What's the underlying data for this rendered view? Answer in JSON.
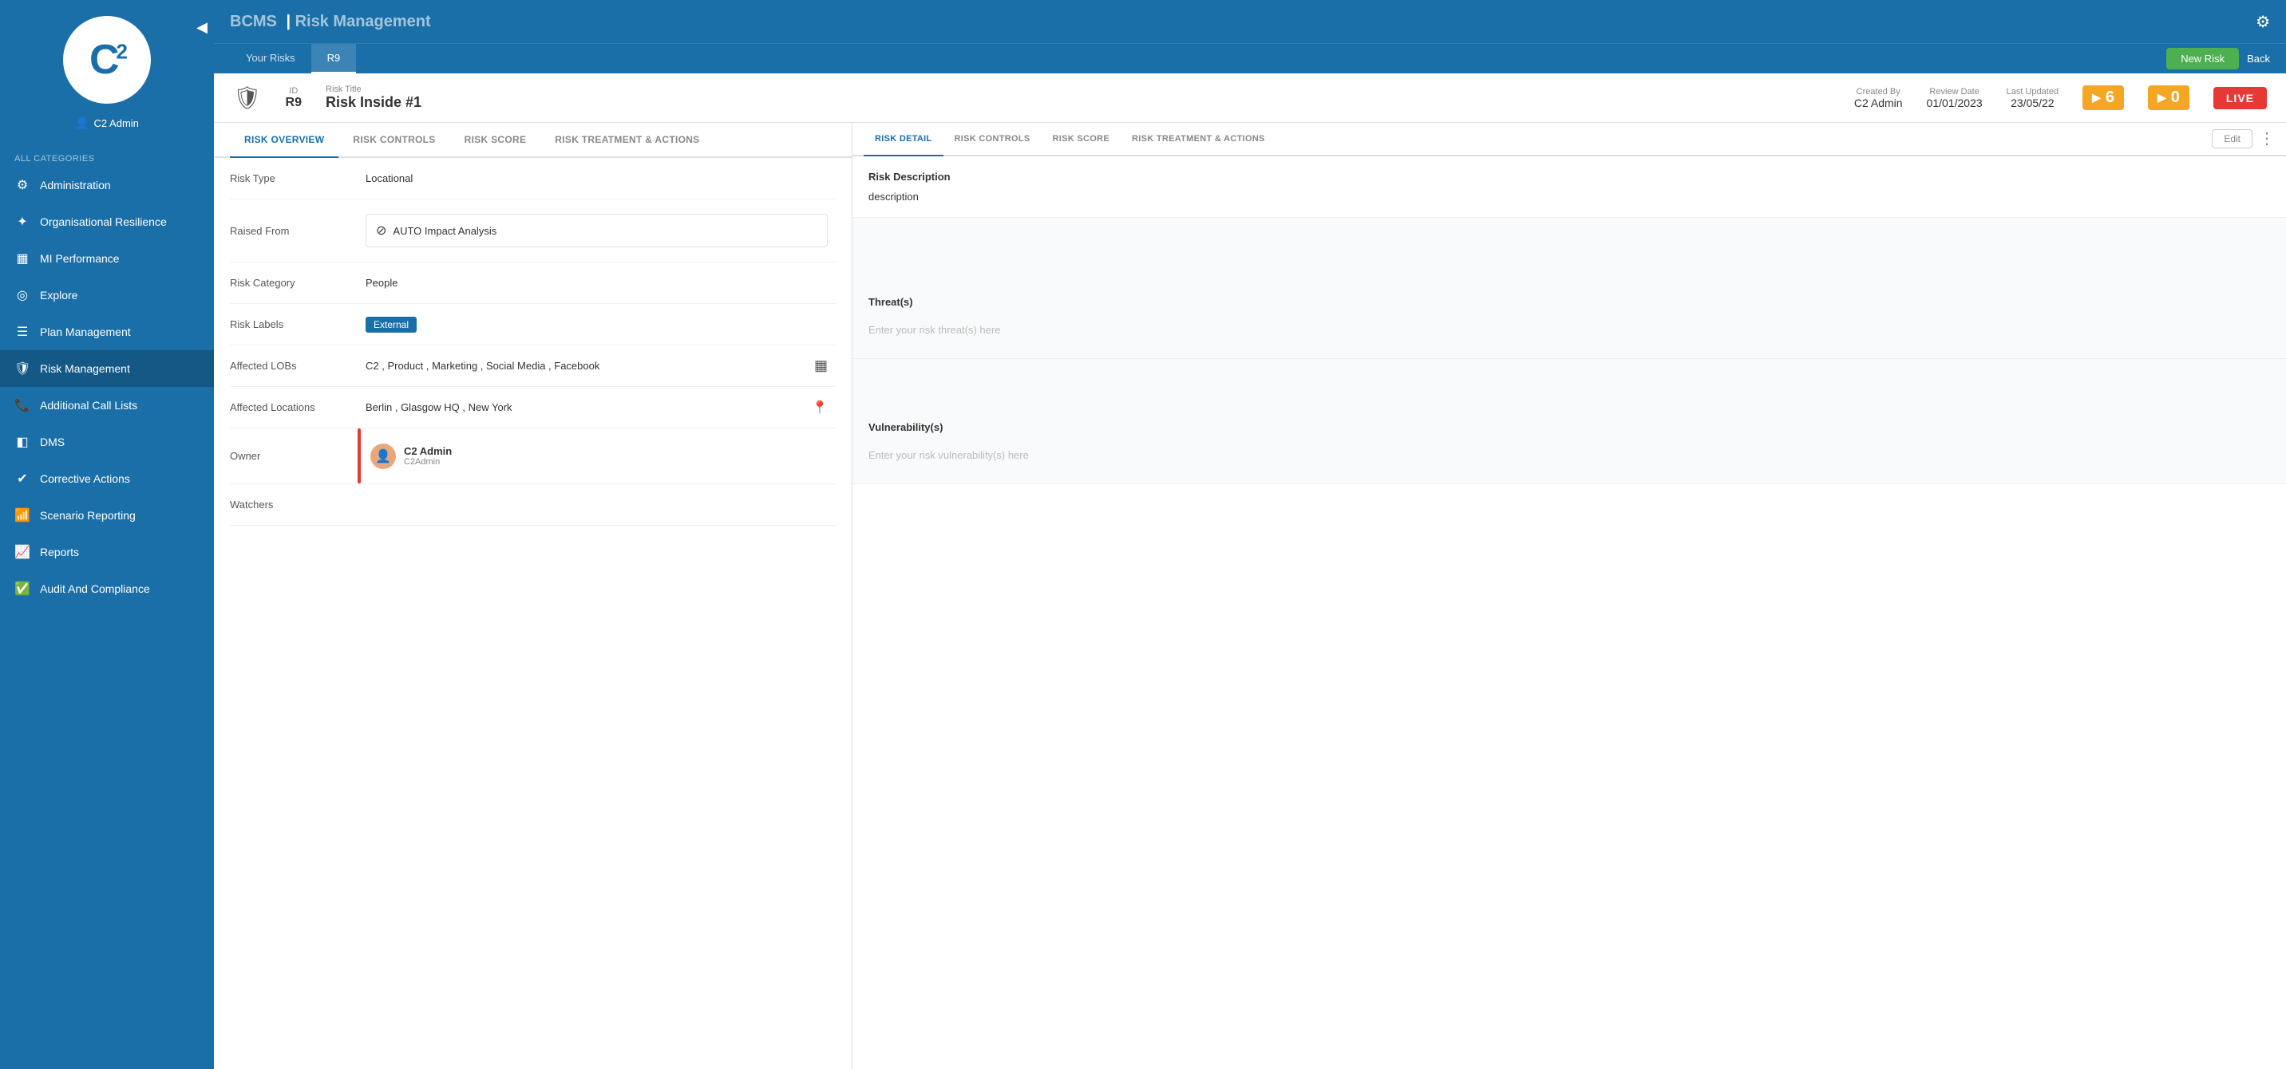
{
  "app": {
    "name": "BCMS",
    "module": "Risk Management",
    "gear_icon": "⚙"
  },
  "sidebar": {
    "logo_text": "C",
    "logo_sup": "2",
    "user": "C2 Admin",
    "categories_label": "All Categories",
    "collapse_icon": "◀",
    "items": [
      {
        "id": "administration",
        "label": "Administration",
        "icon": "⚙"
      },
      {
        "id": "organisational-resilience",
        "label": "Organisational Resilience",
        "icon": "❖"
      },
      {
        "id": "mi-performance",
        "label": "MI Performance",
        "icon": "▦"
      },
      {
        "id": "explore",
        "label": "Explore",
        "icon": "◎"
      },
      {
        "id": "plan-management",
        "label": "Plan Management",
        "icon": "📋"
      },
      {
        "id": "risk-management",
        "label": "Risk Management",
        "icon": "🛡",
        "active": true
      },
      {
        "id": "additional-call-lists",
        "label": "Additional Call Lists",
        "icon": "📞"
      },
      {
        "id": "dms",
        "label": "DMS",
        "icon": "📁"
      },
      {
        "id": "corrective-actions",
        "label": "Corrective Actions",
        "icon": "✔"
      },
      {
        "id": "scenario-reporting",
        "label": "Scenario Reporting",
        "icon": "📊"
      },
      {
        "id": "reports",
        "label": "Reports",
        "icon": "📈"
      },
      {
        "id": "audit-and-compliance",
        "label": "Audit And Compliance",
        "icon": "✅"
      }
    ]
  },
  "tabs": [
    {
      "id": "your-risks",
      "label": "Your Risks"
    },
    {
      "id": "r9",
      "label": "R9",
      "active": true
    }
  ],
  "toolbar": {
    "new_risk_label": "New Risk",
    "back_label": "Back"
  },
  "risk": {
    "id_label": "ID",
    "id_value": "R9",
    "title_label": "Risk Title",
    "title_value": "Risk Inside #1",
    "created_by_label": "Created By",
    "created_by_value": "C2 Admin",
    "review_date_label": "Review Date",
    "review_date_value": "01/01/2023",
    "last_updated_label": "Last Updated",
    "last_updated_value": "23/05/22",
    "badge_orange_icon": "▶",
    "badge_orange_value": "6",
    "badge_orange2_icon": "▶",
    "badge_orange2_value": "0",
    "badge_live": "LIVE"
  },
  "left_panel": {
    "tabs": [
      {
        "id": "risk-overview",
        "label": "Risk Overview",
        "active": true
      },
      {
        "id": "risk-controls",
        "label": "Risk Controls"
      },
      {
        "id": "risk-score",
        "label": "Risk Score"
      },
      {
        "id": "risk-treatment",
        "label": "Risk Treatment & Actions"
      }
    ],
    "form": {
      "risk_type_label": "Risk Type",
      "risk_type_value": "Locational",
      "raised_from_label": "Raised From",
      "raised_from_icon": "🚫",
      "raised_from_value": "AUTO Impact Analysis",
      "risk_category_label": "Risk Category",
      "risk_category_value": "People",
      "risk_labels_label": "Risk Labels",
      "risk_labels_badge": "External",
      "affected_lobs_label": "Affected LOBs",
      "affected_lobs_value": "C2 , Product , Marketing , Social Media , Facebook",
      "affected_lobs_icon": "▦",
      "affected_locations_label": "Affected Locations",
      "affected_locations_value": "Berlin , Glasgow HQ , New York",
      "affected_locations_icon": "📍",
      "owner_label": "Owner",
      "owner_name": "C2 Admin",
      "owner_sub": "C2Admin",
      "watchers_label": "Watchers"
    }
  },
  "right_panel": {
    "tabs": [
      {
        "id": "risk-detail",
        "label": "Risk Detail",
        "active": true
      },
      {
        "id": "risk-controls",
        "label": "Risk Controls"
      },
      {
        "id": "risk-score",
        "label": "Risk Score"
      },
      {
        "id": "risk-treatment",
        "label": "Risk Treatment & Actions"
      }
    ],
    "edit_label": "Edit",
    "more_icon": "⋮",
    "risk_description_title": "Risk Description",
    "risk_description_value": "description",
    "threats_title": "Threat(s)",
    "threats_placeholder": "Enter your risk threat(s) here",
    "vulnerability_title": "Vulnerability(s)",
    "vulnerability_placeholder": "Enter your risk vulnerability(s) here"
  }
}
